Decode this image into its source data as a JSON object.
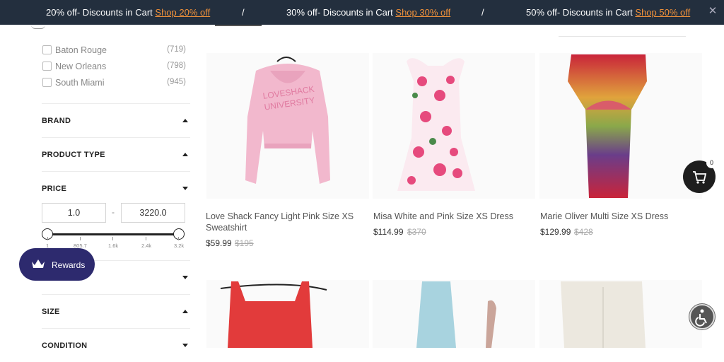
{
  "promo": {
    "items": [
      {
        "text": "20% off- Discounts in Cart",
        "link": "Shop 20% off"
      },
      {
        "text": "30% off- Discounts in Cart",
        "link": "Shop 30% off"
      },
      {
        "text": "50% off- Discounts in Cart",
        "link": "Shop 50% off"
      }
    ],
    "separator": "/",
    "close": "✕"
  },
  "locations": [
    {
      "label": "Baton Rouge",
      "count": "(719)"
    },
    {
      "label": "New Orleans",
      "count": "(798)"
    },
    {
      "label": "South Miami",
      "count": "(945)"
    }
  ],
  "facets": {
    "brand": "BRAND",
    "product_type": "PRODUCT TYPE",
    "price": "PRICE",
    "size": "SIZE",
    "condition": "CONDITION"
  },
  "price": {
    "min": "1.0",
    "max": "3220.0",
    "dash": "-",
    "ticks": [
      "1",
      "805.7",
      "1.6k",
      "2.4k",
      "3.2k"
    ]
  },
  "rewards": {
    "label": "Rewards"
  },
  "cart": {
    "count": "0"
  },
  "products": [
    {
      "name": "Love Shack Fancy Light Pink Size XS Sweatshirt",
      "price": "$59.99",
      "was": "$195"
    },
    {
      "name": "Misa White and Pink Size XS Dress",
      "price": "$114.99",
      "was": "$370"
    },
    {
      "name": "Marie Oliver Multi Size XS Dress",
      "price": "$129.99",
      "was": "$428"
    }
  ],
  "colors": {
    "promo_bg": "#232f3e",
    "promo_link": "#f0913a",
    "rewards_bg": "#2d2a6e"
  }
}
